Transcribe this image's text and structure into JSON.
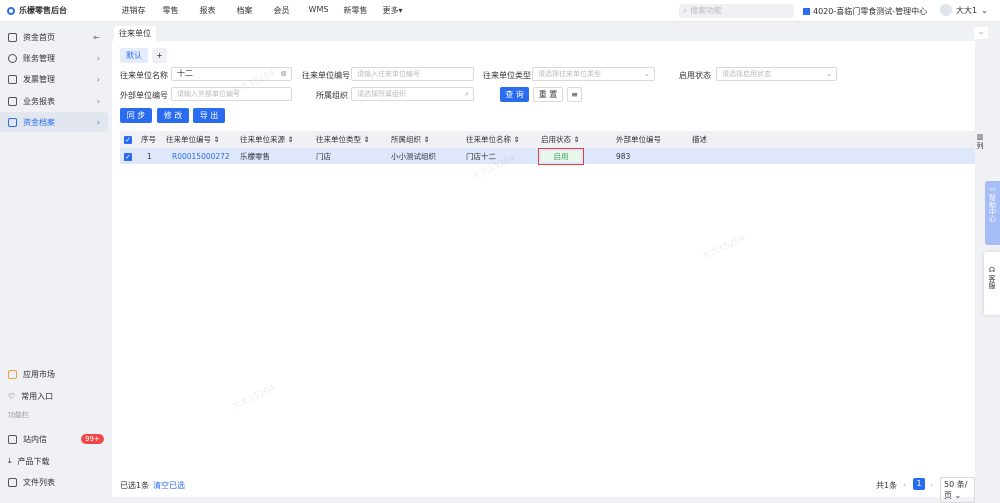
{
  "app": {
    "title": "乐檬零售后台"
  },
  "nav": [
    "进销存",
    "零售",
    "报表",
    "档案",
    "会员",
    "WMS",
    "新零售",
    "更多▾"
  ],
  "header": {
    "search_placeholder": "搜索功能",
    "org": "4020-喜临门零食测试-管理中心",
    "user": "大大1"
  },
  "sidebar": {
    "items": [
      {
        "label": "资金首页",
        "suffix": "⇤"
      },
      {
        "label": "账务管理",
        "suffix": "›"
      },
      {
        "label": "发票管理",
        "suffix": "›"
      },
      {
        "label": "业务报表",
        "suffix": "›"
      },
      {
        "label": "资金档案",
        "suffix": "›"
      }
    ],
    "bottom": [
      {
        "label": "应用市场"
      },
      {
        "label": "常用入口"
      }
    ],
    "section": "功能栏",
    "tools": [
      {
        "label": "站内信",
        "badge": "99+"
      },
      {
        "label": "产品下载"
      },
      {
        "label": "文件列表"
      }
    ]
  },
  "tab": "往来单位",
  "view": {
    "default": "默认",
    "add": "+"
  },
  "filters": {
    "name_label": "往来单位名称",
    "name_value": "十二",
    "code_label": "往来单位编号",
    "code_ph": "请输入往来单位编号",
    "type_label": "往来单位类型",
    "type_ph": "请选择往来单位类型",
    "status_label": "启用状态",
    "status_ph": "请选择启用状态",
    "ext_label": "外部单位编号",
    "ext_ph": "请输入外部单位编号",
    "org_label": "所属组织",
    "org_ph": "请选择所属组织",
    "query": "查 询",
    "reset": "重 置"
  },
  "actions": {
    "sync": "同 步",
    "edit": "修 改",
    "export": "导 出"
  },
  "table": {
    "headers": [
      "序号",
      "往来单位编号",
      "往来单位来源",
      "往来单位类型",
      "所属组织",
      "往来单位名称",
      "启用状态",
      "外部单位编号",
      "描述"
    ],
    "rows": [
      [
        "1",
        "R00015000272",
        "乐檬零售",
        "门店",
        "小小测试组织",
        "门店十二",
        "启用",
        "983",
        ""
      ]
    ]
  },
  "footer": {
    "selected": "已选1条",
    "clear": "清空已选",
    "total": "共1条",
    "page": "1",
    "page_size": "50 条/页"
  },
  "right": {
    "columns": "列",
    "help": "帮助中心",
    "service": "客服"
  },
  "watermark": "大大15204"
}
